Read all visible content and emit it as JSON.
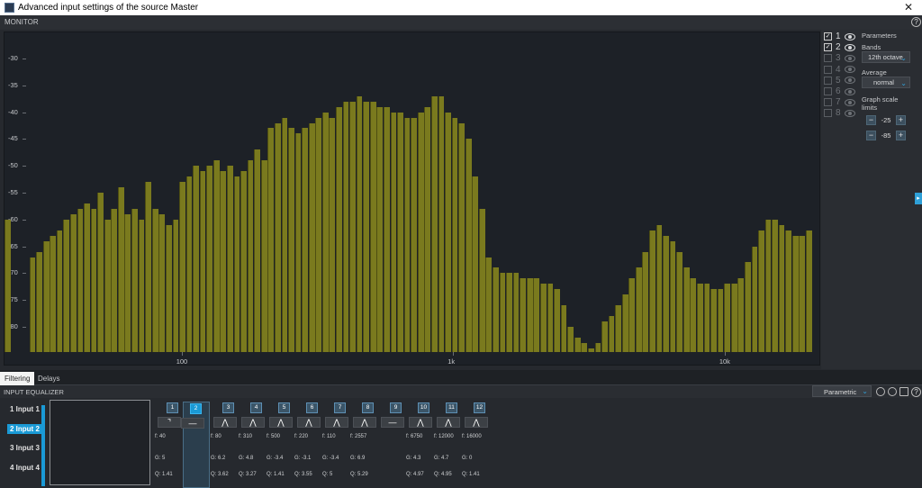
{
  "window": {
    "title": "Advanced input settings of the source Master",
    "close_glyph": "✕"
  },
  "monitor": {
    "label": "MONITOR",
    "help_glyph": "?"
  },
  "chart_data": {
    "type": "bar",
    "x_scale": "log",
    "y_ticks": [
      "-30",
      "-35",
      "-40",
      "-45",
      "-50",
      "-55",
      "-60",
      "-65",
      "-70",
      "-75",
      "-80"
    ],
    "x_ticks": [
      "100",
      "1k",
      "10k"
    ],
    "ylim": [
      -86,
      -30
    ],
    "x": [
      27.5,
      29.1,
      30.9,
      32.7,
      34.6,
      36.7,
      38.9,
      41.2,
      43.7,
      46.2,
      49,
      51.9,
      55,
      58.3,
      61.7,
      65.4,
      69.3,
      73.4,
      77.8,
      82.4,
      87.3,
      92.5,
      98,
      103.8,
      110,
      116.5,
      123.5,
      130.8,
      138.6,
      146.8,
      155.6,
      164.8,
      174.6,
      185,
      196,
      207.7,
      220,
      233.1,
      246.9,
      261.6,
      277.2,
      293.7,
      311.1,
      329.6,
      349.2,
      370,
      392,
      415.3,
      440,
      466.2,
      493.9,
      523.3,
      554.4,
      587.3,
      622.3,
      659.3,
      698.5,
      740,
      784,
      830.6,
      880,
      932.3,
      987.8,
      1046.5,
      1108.7,
      1174.7,
      1244.5,
      1318.5,
      1396.9,
      1480,
      1568,
      1661.2,
      1760,
      1864.7,
      1975.5,
      2093,
      2217.5,
      2349.3,
      2489,
      2637,
      2793.8,
      2960,
      3136,
      3322.4,
      3520,
      3729.3,
      3951.1,
      4186,
      4434.9,
      4698.6,
      4978,
      5274,
      5587.7,
      5919.9,
      6271.9,
      6644.9,
      7040,
      7458.6,
      7902.1,
      8372,
      8869.8,
      9397.3,
      9956.1,
      10548.1,
      11175.3,
      11839.8,
      12543.9,
      13289.8,
      14080,
      14917.2,
      15804.3,
      16744,
      17739.7,
      18794.5,
      19912.1
    ],
    "values": [
      -67,
      -66,
      -64,
      -63,
      -62,
      -60,
      -59,
      -58,
      -57,
      -58,
      -55,
      -60,
      -58,
      -54,
      -59,
      -58,
      -60,
      -53,
      -58,
      -59,
      -61,
      -60,
      -53,
      -52,
      -50,
      -51,
      -50,
      -49,
      -51,
      -50,
      -52,
      -51,
      -49,
      -47,
      -49,
      -43,
      -42,
      -41,
      -43,
      -44,
      -43,
      -42,
      -41,
      -40,
      -41,
      -39,
      -38,
      -38,
      -37,
      -38,
      -38,
      -39,
      -39,
      -40,
      -40,
      -41,
      -41,
      -40,
      -39,
      -37,
      -37,
      -40,
      -41,
      -42,
      -45,
      -52,
      -58,
      -67,
      -69,
      -70,
      -70,
      -70,
      -71,
      -71,
      -71,
      -72,
      -72,
      -73,
      -76,
      -80,
      -82,
      -83,
      -84,
      -83,
      -79,
      -78,
      -76,
      -74,
      -71,
      -69,
      -66,
      -62,
      -61,
      -63,
      -64,
      -66,
      -69,
      -71,
      -72,
      -72,
      -73,
      -73,
      -72,
      -72,
      -71,
      -68,
      -65,
      -62,
      -60,
      -60,
      -61,
      -62,
      -63,
      -63,
      -62,
      -62,
      -61,
      -62,
      -61,
      -60,
      -64,
      -66,
      -70,
      -73,
      -75,
      -77,
      -80,
      -82,
      -83
    ]
  },
  "sidebar": {
    "bands_list": [
      {
        "n": "1",
        "on": true
      },
      {
        "n": "2",
        "on": true
      },
      {
        "n": "3",
        "on": false
      },
      {
        "n": "4",
        "on": false
      },
      {
        "n": "5",
        "on": false
      },
      {
        "n": "6",
        "on": false
      },
      {
        "n": "7",
        "on": false
      },
      {
        "n": "8",
        "on": false
      }
    ],
    "parameters_label": "Parameters",
    "bands_label": "Bands",
    "bands_value": "12th octave",
    "average_label": "Average",
    "average_value": "normal",
    "scale_label": "Graph scale limits",
    "upper_limit": "-25",
    "lower_limit": "-85",
    "minus_glyph": "−",
    "plus_glyph": "+",
    "expand_glyph": "▸"
  },
  "tabs": [
    "Filtering",
    "Delays"
  ],
  "eq": {
    "title": "INPUT EQUALIZER",
    "mode": "Parametric",
    "inputs": [
      {
        "label": "1  Input 1"
      },
      {
        "label": "2  Input 2",
        "selected": true
      },
      {
        "label": "3  Input 3"
      },
      {
        "label": "4  Input 4"
      }
    ],
    "filters": [
      {
        "num": "1",
        "shape": "⌝",
        "f": "f:  40",
        "g": "G:  5",
        "q": "Q:  1.41"
      },
      {
        "num": "2",
        "shape": "—",
        "f": "",
        "g": "",
        "q": "",
        "selected": true
      },
      {
        "num": "3",
        "shape": "⋀",
        "f": "f:  80",
        "g": "G:  6.2",
        "q": "Q:  3.62"
      },
      {
        "num": "4",
        "shape": "⋀",
        "f": "f:  310",
        "g": "G:  4.8",
        "q": "Q:  3.27"
      },
      {
        "num": "5",
        "shape": "⋀",
        "f": "f:  500",
        "g": "G:  -3.4",
        "q": "Q:  1.41"
      },
      {
        "num": "6",
        "shape": "⋀",
        "f": "f:  220",
        "g": "G:  -3.1",
        "q": "Q:  3.55"
      },
      {
        "num": "7",
        "shape": "⋀",
        "f": "f:  110",
        "g": "G:  -3.4",
        "q": "Q:  5"
      },
      {
        "num": "8",
        "shape": "⋀",
        "f": "f:  2557",
        "g": "G:  6.9",
        "q": "Q:  5.29"
      },
      {
        "num": "9",
        "shape": "—",
        "f": "",
        "g": "",
        "q": ""
      },
      {
        "num": "10",
        "shape": "⋀",
        "f": "f:  6750",
        "g": "G:  4.3",
        "q": "Q:  4.97"
      },
      {
        "num": "11",
        "shape": "⋀",
        "f": "f:  12000",
        "g": "G:  4.7",
        "q": "Q:  4.95"
      },
      {
        "num": "12",
        "shape": "⋀",
        "f": "f:  16000",
        "g": "G:  0",
        "q": "Q:  1.41"
      }
    ]
  }
}
